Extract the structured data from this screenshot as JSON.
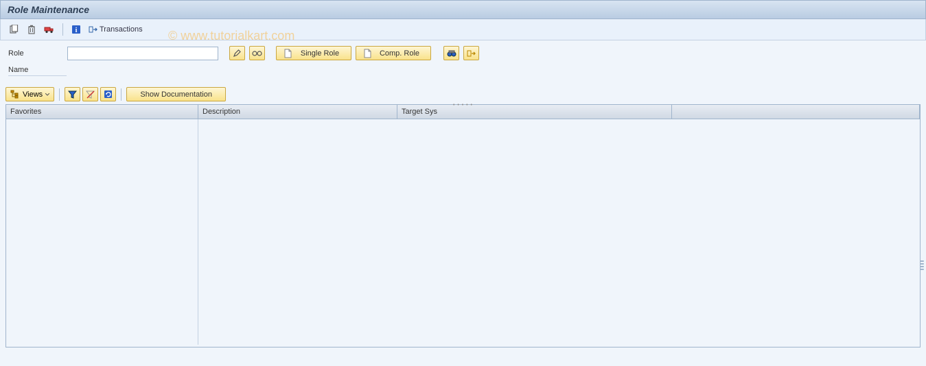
{
  "title": "Role Maintenance",
  "toolbar": {
    "transactions_label": "Transactions"
  },
  "form": {
    "role_label": "Role",
    "role_value": "",
    "name_label": "Name",
    "single_role_label": "Single Role",
    "comp_role_label": "Comp. Role"
  },
  "grid_toolbar": {
    "views_label": "Views",
    "show_doc_label": "Show Documentation"
  },
  "grid": {
    "columns": [
      "Favorites",
      "Description",
      "Target Sys",
      ""
    ]
  },
  "watermark": "© www.tutorialkart.com"
}
